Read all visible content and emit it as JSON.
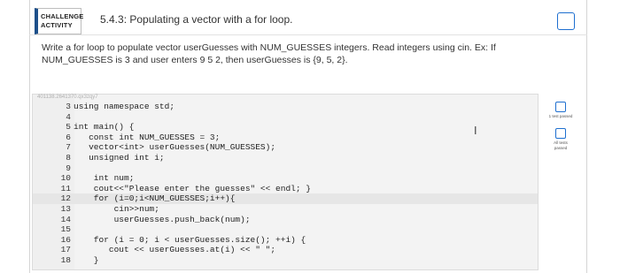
{
  "header": {
    "badge_line1": "CHALLENGE",
    "badge_line2": "ACTIVITY",
    "title": "5.4.3: Populating a vector with a for loop."
  },
  "prompt": "Write a for loop to populate vector userGuesses with NUM_GUESSES integers. Read integers using cin. Ex: If NUM_GUESSES is 3 and user enters 9 5 2, then userGuesses is {9, 5, 2}.",
  "editor": {
    "file_id": "401138.2641370.qx3zqy7",
    "lines": [
      {
        "n": "3",
        "code": "using namespace std;"
      },
      {
        "n": "4",
        "code": ""
      },
      {
        "n": "5",
        "code": "int main() {"
      },
      {
        "n": "6",
        "code": "   const int NUM_GUESSES = 3;"
      },
      {
        "n": "7",
        "code": "   vector<int> userGuesses(NUM_GUESSES);"
      },
      {
        "n": "8",
        "code": "   unsigned int i;"
      },
      {
        "n": "9",
        "code": ""
      },
      {
        "n": "10",
        "code": "    int num;"
      },
      {
        "n": "11",
        "code": "    cout<<\"Please enter the guesses\" << endl; }"
      },
      {
        "n": "12",
        "code": "    for (i=0;i<NUM_GUESSES;i++){"
      },
      {
        "n": "13",
        "code": "        cin>>num;"
      },
      {
        "n": "14",
        "code": "        userGuesses.push_back(num);"
      },
      {
        "n": "15",
        "code": ""
      },
      {
        "n": "16",
        "code": "    for (i = 0; i < userGuesses.size(); ++i) {"
      },
      {
        "n": "17",
        "code": "       cout << userGuesses.at(i) << \" \";"
      },
      {
        "n": "18",
        "code": "    }"
      }
    ],
    "highlighted_line": "12",
    "cursor_glyph": "I"
  },
  "side": {
    "test1_label": "1 test passed",
    "test2_label": "All tests passed"
  },
  "colors": {
    "accent": "#1e6fd0",
    "badge_bar": "#1d4f8a"
  }
}
